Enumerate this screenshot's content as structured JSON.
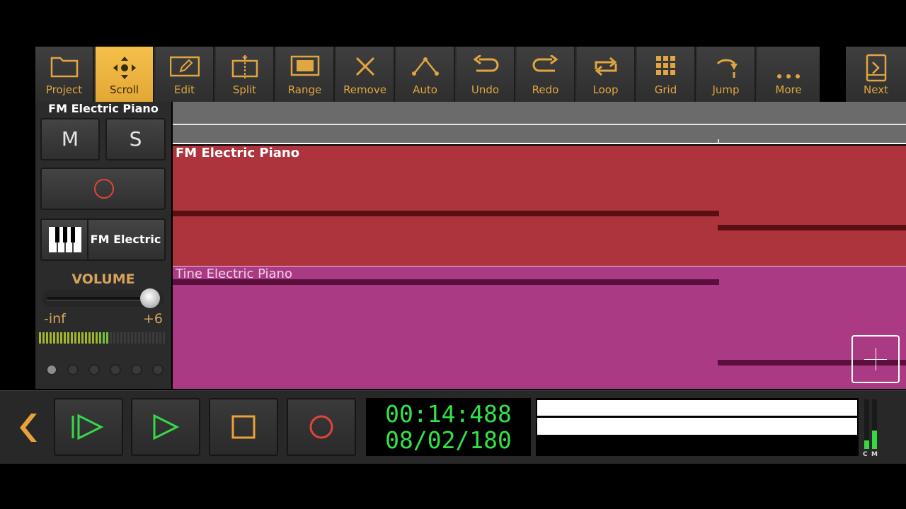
{
  "toolbar": {
    "items": [
      {
        "label": "Project",
        "icon": "folder-icon"
      },
      {
        "label": "Scroll",
        "icon": "scroll-arrows-icon",
        "active": true
      },
      {
        "label": "Edit",
        "icon": "pencil-icon"
      },
      {
        "label": "Split",
        "icon": "split-icon"
      },
      {
        "label": "Range",
        "icon": "range-icon"
      },
      {
        "label": "Remove",
        "icon": "x-icon"
      },
      {
        "label": "Auto",
        "icon": "automation-icon"
      },
      {
        "label": "Undo",
        "icon": "undo-icon"
      },
      {
        "label": "Redo",
        "icon": "redo-icon"
      },
      {
        "label": "Loop",
        "icon": "loop-icon"
      },
      {
        "label": "Grid",
        "icon": "grid-icon"
      },
      {
        "label": "Jump",
        "icon": "jump-icon"
      },
      {
        "label": "More",
        "icon": "more-dots-icon"
      }
    ],
    "next_label": "Next"
  },
  "track": {
    "title": "FM Electric Piano",
    "mute_label": "M",
    "solo_label": "S",
    "instrument_name": "FM Electric",
    "volume_label": "VOLUME",
    "volume_min_label": "-inf",
    "volume_max_label": "+6",
    "volume_level": 0.97,
    "meter_level": 0.56
  },
  "regions": {
    "fm_name": "FM Electric Piano",
    "tine_name": "Tine Electric Piano"
  },
  "transport": {
    "time": "00:14:488",
    "position": "08/02/180",
    "master_meter_labels": [
      "C",
      "M"
    ]
  },
  "colors": {
    "accent": "#e0a640",
    "fm_region": "#ad343c",
    "tine_region": "#ab3a84",
    "time_text": "#33e24a"
  }
}
